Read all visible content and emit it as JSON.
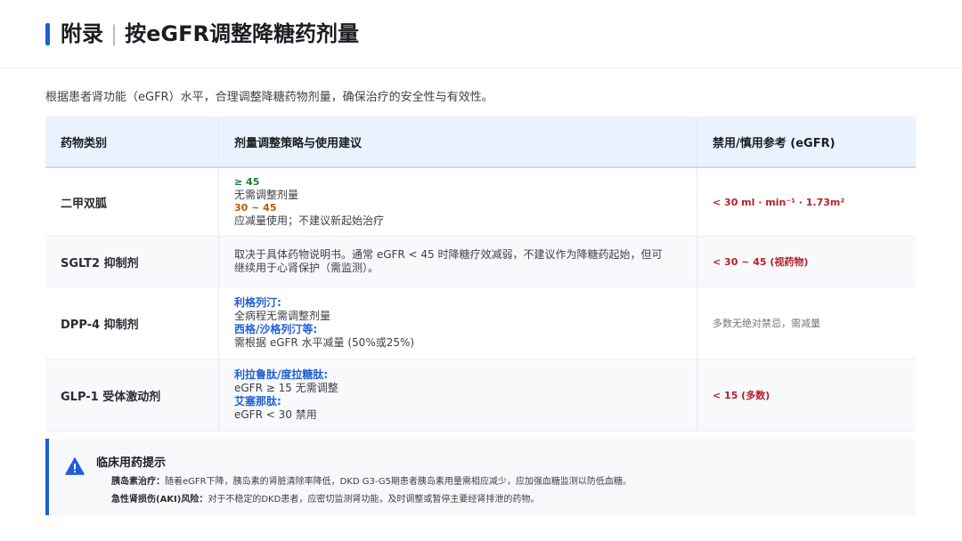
{
  "header": {
    "title_left": "附录",
    "separator": "|",
    "title_right": "按eGFR调整降糖药剂量"
  },
  "intro": "根据患者肾功能（eGFR）水平，合理调整降糖药物剂量，确保治疗的安全性与有效性。",
  "table": {
    "columns": [
      "药物类别",
      "剂量调整策略与使用建议",
      "禁用/慎用参考 (eGFR)"
    ],
    "rows": [
      {
        "drug": "二甲双胍",
        "strategy": [
          {
            "type": "green",
            "text": "≥ 45"
          },
          {
            "type": "text",
            "text": "无需调整剂量"
          },
          {
            "type": "orange",
            "text": "30 ~ 45"
          },
          {
            "type": "text",
            "text": "应减量使用；不建议新起始治疗"
          }
        ],
        "reference": "< 30 ml · min⁻¹ · 1.73m²",
        "reference_style": "red"
      },
      {
        "drug": "SGLT2 抑制剂",
        "strategy": [
          {
            "type": "text",
            "text": "取决于具体药物说明书。通常 eGFR < 45 时降糖疗效减弱，不建议作为降糖药起始，但可"
          },
          {
            "type": "text",
            "text": "继续用于心肾保护（需监测）。"
          }
        ],
        "reference": "< 30 ~ 45 (视药物)",
        "reference_style": "red"
      },
      {
        "drug": "DPP-4 抑制剂",
        "strategy": [
          {
            "type": "blue",
            "text": "利格列汀:"
          },
          {
            "type": "text",
            "text": "全病程无需调整剂量"
          },
          {
            "type": "blue",
            "text": "西格/沙格列汀等:"
          },
          {
            "type": "text",
            "text": "需根据 eGFR 水平减量 (50%或25%)"
          }
        ],
        "reference": "多数无绝对禁忌，需减量",
        "reference_style": "gray"
      },
      {
        "drug": "GLP-1 受体激动剂",
        "strategy": [
          {
            "type": "blue",
            "text": "利拉鲁肽/度拉糖肽:"
          },
          {
            "type": "text",
            "text": "eGFR ≥ 15 无需调整"
          },
          {
            "type": "blue",
            "text": "艾塞那肽:"
          },
          {
            "type": "text",
            "text": "eGFR < 30 禁用"
          }
        ],
        "reference": "< 15 (多数)",
        "reference_style": "red"
      }
    ]
  },
  "note": {
    "icon": "warning-icon",
    "title": "临床用药提示",
    "items": [
      {
        "label": "胰岛素治疗：",
        "text": "随着eGFR下降，胰岛素的肾脏清除率降低，DKD G3-G5期患者胰岛素用量需相应减少，应加强血糖监测以防低血糖。"
      },
      {
        "label": "急性肾损伤(AKI)风险：",
        "text": "对于不稳定的DKD患者，应密切监测肾功能，及时调整或暂停主要经肾排泄的药物。"
      }
    ]
  },
  "colors": {
    "accent": "#1e5fd6",
    "green": "#1f7a3a",
    "orange": "#b05d0e",
    "red": "#b3202b"
  }
}
